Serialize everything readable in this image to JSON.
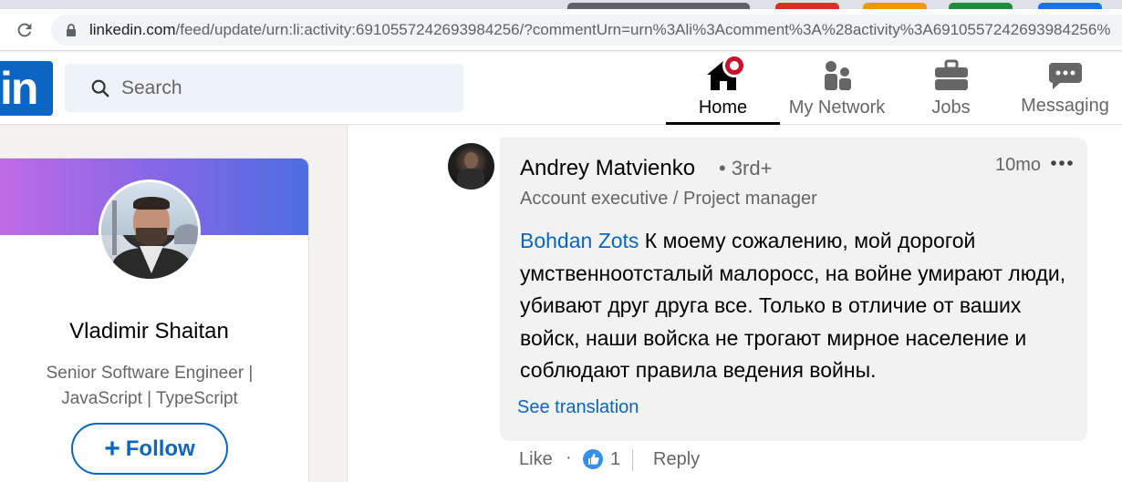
{
  "browser": {
    "url_host": "linkedin.com",
    "url_path": "/feed/update/urn:li:activity:6910557242693984256/?commentUrn=urn%3Ali%3Acomment%3A%28activity%3A6910557242693984256%"
  },
  "linkedin": {
    "logo_text": "in",
    "search_placeholder": "Search",
    "nav": [
      {
        "label": "Home",
        "icon": "home-icon",
        "active": true
      },
      {
        "label": "My Network",
        "icon": "network-icon"
      },
      {
        "label": "Jobs",
        "icon": "briefcase-icon"
      },
      {
        "label": "Messaging",
        "icon": "messaging-icon"
      }
    ],
    "brand_color": "#0a66c2"
  },
  "profile": {
    "name": "Vladimir Shaitan",
    "headline": "Senior Software Engineer | JavaScript | TypeScript",
    "follow_label": "Follow",
    "follow_plus": "+"
  },
  "comment": {
    "author": "Andrey Matvienko",
    "degree": "• 3rd+",
    "timestamp": "10mo",
    "more": "•••",
    "headline": "Account executive / Project manager",
    "mention": "Bohdan Zots",
    "text": " К моему сожалению, мой дорогой умственноотсталый малоросс, на войне умирают люди, убивают друг друга все. Только в отличие от ваших войск, наши войска не трогают мирное население и соблюдают правила ведения войны.",
    "see_translation": "See translation",
    "like_label": "Like",
    "separator": "·",
    "like_count": "1",
    "reply_label": "Reply"
  }
}
